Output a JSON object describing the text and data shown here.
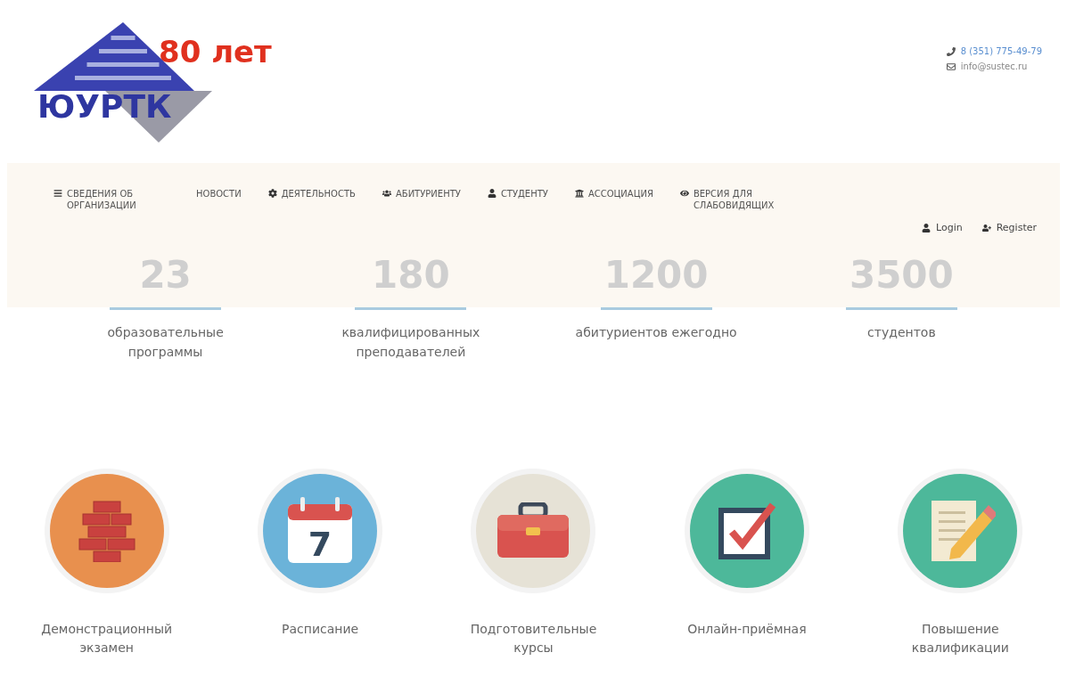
{
  "logo": {
    "name": "ЮУРТК",
    "anniversary": "80 лет"
  },
  "contacts": [
    {
      "kind": "phone",
      "text": "8 (351) 775-49-79"
    },
    {
      "kind": "email",
      "text": "info@sustec.ru"
    }
  ],
  "nav": [
    {
      "kind": "list",
      "label": "СВЕДЕНИЯ ОБ ОРГАНИЗАЦИИ"
    },
    {
      "kind": "plain",
      "label": "НОВОСТИ"
    },
    {
      "kind": "gear",
      "label": "ДЕЯТЕЛЬНОСТЬ"
    },
    {
      "kind": "group",
      "label": "АБИТУРИЕНТУ"
    },
    {
      "kind": "user",
      "label": "СТУДЕНТУ"
    },
    {
      "kind": "bank",
      "label": "АССОЦИАЦИЯ"
    },
    {
      "kind": "eye",
      "label": "ВЕРСИЯ ДЛЯ СЛАБОВИДЯЩИХ"
    }
  ],
  "auth": [
    {
      "kind": "user",
      "label": "Login"
    },
    {
      "kind": "userplus",
      "label": "Register"
    }
  ],
  "stats": [
    {
      "number": "23",
      "label": "образовательные программы"
    },
    {
      "number": "180",
      "label": "квалифицированных преподавателей"
    },
    {
      "number": "1200",
      "label": "абитуриентов ежегодно"
    },
    {
      "number": "3500",
      "label": "студентов"
    }
  ],
  "services": [
    {
      "kind": "bricks",
      "label": "Демонстрационный экзамен",
      "color": "#e8904e"
    },
    {
      "kind": "calendar",
      "label": "Расписание",
      "color": "#6bb3d9",
      "calendar_day": "7"
    },
    {
      "kind": "briefcase",
      "label": "Подготовительные курсы",
      "color": "#e6e2d6"
    },
    {
      "kind": "checkbox",
      "label": "Онлайн-приёмная",
      "color": "#4db89a"
    },
    {
      "kind": "notepad",
      "label": "Повышение квалификации",
      "color": "#4db89a"
    }
  ]
}
